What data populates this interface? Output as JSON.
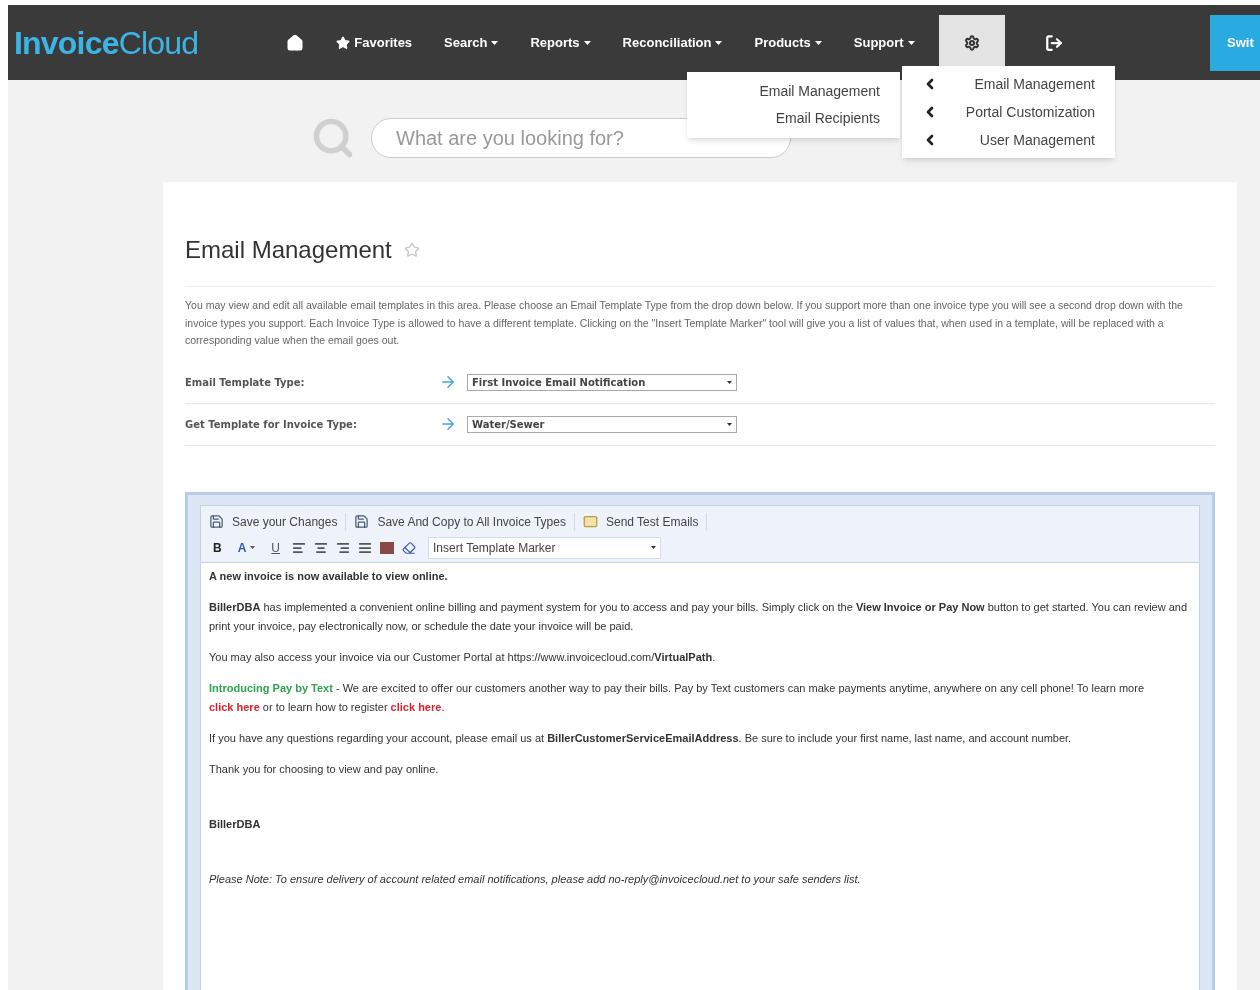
{
  "logo": {
    "primary": "Invoice",
    "secondary": "Cloud"
  },
  "nav": {
    "items": [
      {
        "kind": "home"
      },
      {
        "kind": "favorites",
        "label": "Favorites"
      },
      {
        "kind": "dropdown",
        "label": "Search"
      },
      {
        "kind": "dropdown",
        "label": "Reports"
      },
      {
        "kind": "dropdown",
        "label": "Reconciliation"
      },
      {
        "kind": "dropdown",
        "label": "Products"
      },
      {
        "kind": "dropdown",
        "label": "Support"
      },
      {
        "kind": "settings",
        "selected": true
      },
      {
        "kind": "logout"
      }
    ],
    "switch_button": "Swit"
  },
  "settings_menu": {
    "items": [
      "Email Management",
      "Portal Customization",
      "User Management"
    ]
  },
  "submenu": {
    "items": [
      "Email Management",
      "Email Recipients"
    ]
  },
  "search": {
    "placeholder": "What are you looking for?"
  },
  "page": {
    "title": "Email Management",
    "favorite": false,
    "description": "You may view and edit all available email templates in this area. Please choose an Email Template Type from the drop down below. If you support more than one invoice type you will see a second drop down with the invoice types you support. Each Invoice Type is allowed to have a different template. Clicking on the \"Insert Template Marker\" tool will give you a list of values that, when used in a template, will be replaced with a corresponding value when the email goes out.",
    "fields": [
      {
        "label": "Email Template Type:",
        "value": "First Invoice Email Notification"
      },
      {
        "label": "Get Template for Invoice Type:",
        "value": "Water/Sewer"
      }
    ]
  },
  "editor": {
    "actions": [
      {
        "kind": "save",
        "label": "Save your Changes"
      },
      {
        "kind": "save",
        "label": "Save And Copy to All Invoice Types"
      },
      {
        "kind": "mail",
        "label": "Send Test Emails"
      }
    ],
    "format_buttons": [
      {
        "kind": "bold",
        "label": "B"
      },
      {
        "kind": "color",
        "label": "A"
      },
      {
        "kind": "underline",
        "label": "U"
      }
    ],
    "marker_select": "Insert Template Marker",
    "paragraphs": [
      {
        "kind": "bold",
        "text": "A new invoice is now available to view online."
      },
      {
        "kind": "rich",
        "text": "**BillerDBA** has implemented a convenient online billing and payment system for you to access and pay your bills. Simply click on the **View Invoice or Pay Now** button to get started. You can review and print your invoice, pay electronically now, or schedule the date your invoice will be paid."
      },
      {
        "kind": "plain",
        "text": "You may also access your invoice via our Customer Portal at https://www.invoicecloud.com/**VirtualPath**."
      },
      {
        "kind": "segments",
        "segments": [
          {
            "kind": "highlight",
            "text": "Introducing Pay by Text"
          },
          {
            "kind": "plain",
            "text": " - We are excited to offer our customers another way to pay their bills. Pay by Text customers can make payments anytime, anywhere on any cell phone!  To learn more "
          },
          {
            "kind": "link",
            "text": "click here"
          },
          {
            "kind": "plain",
            "text": " or to learn how to register "
          },
          {
            "kind": "link",
            "text": "click here"
          },
          {
            "kind": "plain",
            "text": "."
          }
        ]
      },
      {
        "kind": "plain",
        "text": "If you have any questions regarding your account, please email us at **BillerCustomerServiceEmailAddress**. Be sure to include your first name, last name, and account number."
      },
      {
        "kind": "plain",
        "text": "Thank you for choosing to view and pay online."
      },
      {
        "kind": "signature",
        "text": "**BillerDBA**"
      },
      {
        "kind": "note",
        "text": "Please Note: To ensure delivery of account related email notifications, please add no-reply@invoicecloud.net to your safe senders list."
      }
    ]
  }
}
